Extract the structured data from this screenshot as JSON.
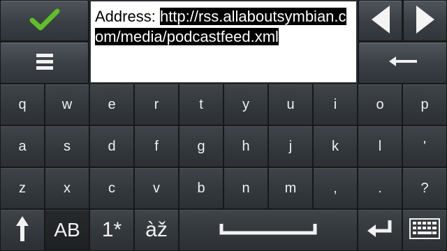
{
  "editor": {
    "label": "Address:",
    "value": "http://rss.allaboutsymbian.com/media/podcastfeed.xml"
  },
  "controls": {
    "confirm_icon": "checkmark-icon",
    "menu_icon": "menu-icon",
    "left_icon": "arrow-left-icon",
    "right_icon": "arrow-right-icon",
    "backspace_icon": "backspace-icon"
  },
  "keyboard": {
    "rows": [
      [
        "q",
        "w",
        "e",
        "r",
        "t",
        "y",
        "u",
        "i",
        "o",
        "p"
      ],
      [
        "a",
        "s",
        "d",
        "f",
        "g",
        "h",
        "j",
        "k",
        "l",
        "'"
      ],
      [
        "z",
        "x",
        "c",
        "v",
        "b",
        "n",
        "m",
        ",",
        ".",
        "?"
      ]
    ],
    "bottom": {
      "shift_icon": "shift-arrow-icon",
      "case_label": "AB",
      "numbers_label": "1*",
      "accents_label": "àž",
      "space_icon": "space-bar-icon",
      "enter_icon": "enter-icon",
      "layout_icon": "keyboard-icon"
    }
  },
  "colors": {
    "checkmark": "#5fbf2a",
    "key_text": "#f0f0f0",
    "selection_bg": "#000000"
  }
}
